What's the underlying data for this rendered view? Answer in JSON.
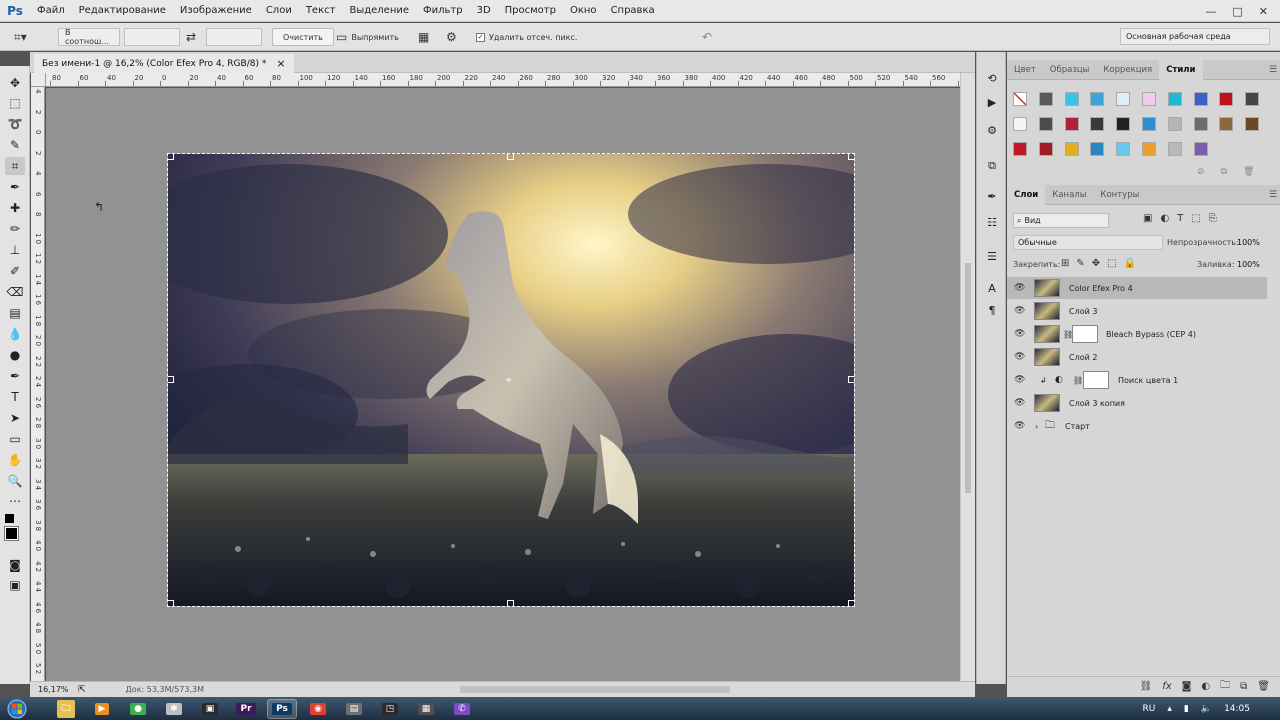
{
  "app": {
    "logo": "Ps"
  },
  "menu": [
    "Файл",
    "Редактирование",
    "Изображение",
    "Слои",
    "Текст",
    "Выделение",
    "Фильтр",
    "3D",
    "Просмотр",
    "Окно",
    "Справка"
  ],
  "window_controls": [
    "—",
    "□",
    "✕"
  ],
  "options": {
    "ratio_select": "В соотнош...",
    "clear_button": "Очистить",
    "straighten_button": "Выпрямить",
    "delete_cropped_label": "Удалить отсеч. пикс.",
    "delete_cropped_checked": true,
    "workspace": "Основная рабочая среда"
  },
  "document": {
    "tab_title": "Без имени-1 @ 16,2% (Color Efex Pro 4, RGB/8) *",
    "close": "×"
  },
  "ruler": {
    "h_labels": [
      "80",
      "60",
      "40",
      "20",
      "0",
      "20",
      "40",
      "60",
      "80",
      "100",
      "120",
      "140",
      "160",
      "180",
      "200",
      "220",
      "240",
      "260",
      "280",
      "300",
      "320",
      "340",
      "360",
      "380",
      "400",
      "420",
      "440",
      "460",
      "480",
      "500",
      "520",
      "540",
      "560",
      "580",
      "600",
      "620"
    ],
    "v_labels": [
      "4",
      "2",
      "0",
      "2",
      "4",
      "6",
      "8",
      "1 0",
      "1 2",
      "1 4",
      "1 6",
      "1 8",
      "2 0",
      "2 2",
      "2 4",
      "2 6",
      "2 8",
      "3 0",
      "3 2",
      "3 4",
      "3 6",
      "3 8",
      "4 0",
      "4 2",
      "4 4",
      "4 6",
      "4 8",
      "5 0",
      "5 2"
    ]
  },
  "status": {
    "zoom": "16,17%",
    "doc": "Док: 53,3M/573,3M"
  },
  "panels": {
    "styles_tabs": [
      {
        "label": "Цвет",
        "active": false
      },
      {
        "label": "Образцы",
        "active": false
      },
      {
        "label": "Коррекция",
        "active": false
      },
      {
        "label": "Стили",
        "active": true
      }
    ],
    "style_swatch_colors": [
      "#f4f4f4",
      "#5a5a5a",
      "#2fc6ea",
      "#3aa6d8",
      "#dfeffa",
      "#f3c9ef",
      "#1fb9d6",
      "#3e5fc9",
      "#c0121e",
      "#444444",
      "#f4f4f4",
      "#4c4c4c",
      "#b0203a",
      "#3a3a3a",
      "#222222",
      "#2c90d8",
      "#b5b5b5",
      "#6c6c6c",
      "#8a6a3c",
      "#6a4a22",
      "#c01828",
      "#a21b27",
      "#e0b020",
      "#2886c0",
      "#68c8ee",
      "#e8a028",
      "#b8b8b8",
      "#7a5ca8"
    ],
    "layers_tabs": [
      {
        "label": "Слои",
        "active": true
      },
      {
        "label": "Каналы",
        "active": false
      },
      {
        "label": "Контуры",
        "active": false
      }
    ],
    "filter_kind": "Вид",
    "blend_mode": "Обычные",
    "opacity_label": "Непрозрачность:",
    "opacity_value": "100%",
    "lock_label": "Закрепить:",
    "fill_label": "Заливка:",
    "fill_value": "100%",
    "layers": [
      {
        "name": "Color Efex Pro 4",
        "selected": true,
        "type": "image"
      },
      {
        "name": "Слой 3",
        "selected": false,
        "type": "image"
      },
      {
        "name": "Bleach Bypass (CEP 4)",
        "selected": false,
        "type": "masked"
      },
      {
        "name": "Слой 2",
        "selected": false,
        "type": "image"
      },
      {
        "name": "Поиск цвета 1",
        "selected": false,
        "type": "adjustment"
      },
      {
        "name": "Слой 3 копия",
        "selected": false,
        "type": "image"
      },
      {
        "name": "Старт",
        "selected": false,
        "type": "group"
      }
    ]
  },
  "taskbar": {
    "apps": [
      {
        "label": "🗀",
        "color": "#e8c050"
      },
      {
        "label": "▶",
        "color": "#e89020"
      },
      {
        "label": "●",
        "color": "#3cb050"
      },
      {
        "label": "✱",
        "color": "#bfbfbf"
      },
      {
        "label": "▣",
        "color": "#2a2a2a"
      },
      {
        "label": "Pr",
        "color": "#3a1a5a"
      },
      {
        "label": "Ps",
        "color": "#0e3a60"
      },
      {
        "label": "◉",
        "color": "#e04030"
      },
      {
        "label": "▤",
        "color": "#707070"
      },
      {
        "label": "◳",
        "color": "#2a2a2a"
      },
      {
        "label": "▦",
        "color": "#505050"
      },
      {
        "label": "✆",
        "color": "#7a4cc0"
      }
    ],
    "lang": "RU",
    "time": "14:05"
  }
}
